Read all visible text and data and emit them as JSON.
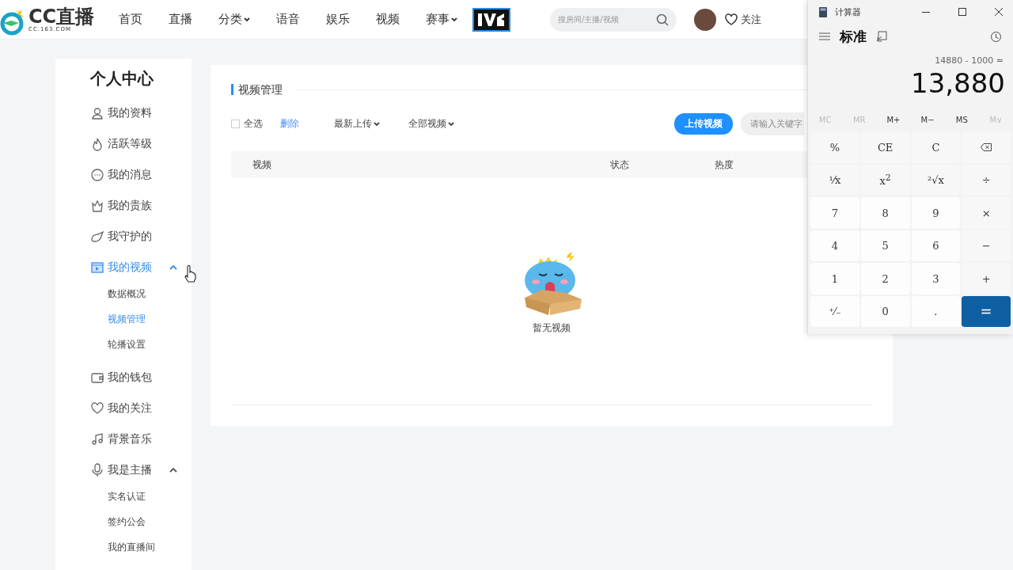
{
  "nav": {
    "logo_text": "CC直播",
    "logo_sub": "CC.163.COM",
    "items": [
      {
        "label": "首页",
        "dropdown": false
      },
      {
        "label": "直播",
        "dropdown": false
      },
      {
        "label": "分类",
        "dropdown": true
      },
      {
        "label": "语音",
        "dropdown": false
      },
      {
        "label": "娱乐",
        "dropdown": false
      },
      {
        "label": "视频",
        "dropdown": false
      },
      {
        "label": "赛事",
        "dropdown": true
      }
    ],
    "search": {
      "placeholder": "搜房间/主播/视频"
    },
    "follow": "关注"
  },
  "sidebar": {
    "title": "个人中心",
    "items": [
      {
        "label": "我的资料",
        "selected": false
      },
      {
        "label": "活跃等级",
        "selected": false
      },
      {
        "label": "我的消息",
        "selected": false
      },
      {
        "label": "我的贵族",
        "selected": false
      },
      {
        "label": "我守护的",
        "selected": false
      },
      {
        "label": "我的视频",
        "selected": true,
        "expanded": true,
        "children": [
          {
            "label": "数据概况",
            "selected": false
          },
          {
            "label": "视频管理",
            "selected": true
          },
          {
            "label": "轮播设置",
            "selected": false
          }
        ]
      },
      {
        "label": "我的钱包",
        "selected": false
      },
      {
        "label": "我的关注",
        "selected": false
      },
      {
        "label": "背景音乐",
        "selected": false
      },
      {
        "label": "我是主播",
        "selected": false,
        "expanded": true,
        "children": [
          {
            "label": "实名认证",
            "selected": false
          },
          {
            "label": "签约公会",
            "selected": false
          },
          {
            "label": "我的直播间",
            "selected": false
          }
        ]
      }
    ]
  },
  "main": {
    "title": "视频管理",
    "select_all": {
      "label": "全选",
      "checked": false
    },
    "delete": "删除",
    "filters": [
      "最新上传",
      "全部视频"
    ],
    "upload": "上传视频",
    "search": {
      "placeholder": "请输入关键字"
    },
    "columns": [
      "视频",
      "状态",
      "热度"
    ],
    "empty": "暂无视频"
  },
  "calculator": {
    "title": "计算器",
    "mode": "标准",
    "expression": "14880 - 1000 =",
    "display": "13,880",
    "memory": [
      {
        "label": "MC",
        "disabled": true
      },
      {
        "label": "MR",
        "disabled": true
      },
      {
        "label": "M+",
        "disabled": false
      },
      {
        "label": "M−",
        "disabled": false
      },
      {
        "label": "MS",
        "disabled": false
      },
      {
        "label": "M∨",
        "disabled": true
      }
    ],
    "keys": [
      {
        "label": "%",
        "kind": "fn"
      },
      {
        "label": "CE",
        "kind": "fn"
      },
      {
        "label": "C",
        "kind": "fn"
      },
      {
        "kind": "backspace"
      },
      {
        "label": "¹⁄x",
        "kind": "fn"
      },
      {
        "label": "x$^{2}$",
        "kind": "fn"
      },
      {
        "label": "²√x",
        "kind": "fn"
      },
      {
        "label": "÷",
        "kind": "fn"
      },
      {
        "label": "7",
        "kind": "digit"
      },
      {
        "label": "8",
        "kind": "digit"
      },
      {
        "label": "9",
        "kind": "digit"
      },
      {
        "label": "×",
        "kind": "fn"
      },
      {
        "label": "4",
        "kind": "digit"
      },
      {
        "label": "5",
        "kind": "digit"
      },
      {
        "label": "6",
        "kind": "digit"
      },
      {
        "label": "−",
        "kind": "fn"
      },
      {
        "label": "1",
        "kind": "digit"
      },
      {
        "label": "2",
        "kind": "digit"
      },
      {
        "label": "3",
        "kind": "digit"
      },
      {
        "label": "+",
        "kind": "fn"
      },
      {
        "label": "⁺⁄₋",
        "kind": "digit"
      },
      {
        "label": "0",
        "kind": "digit"
      },
      {
        "label": ".",
        "kind": "digit"
      },
      {
        "label": "=",
        "kind": "equals"
      }
    ]
  }
}
